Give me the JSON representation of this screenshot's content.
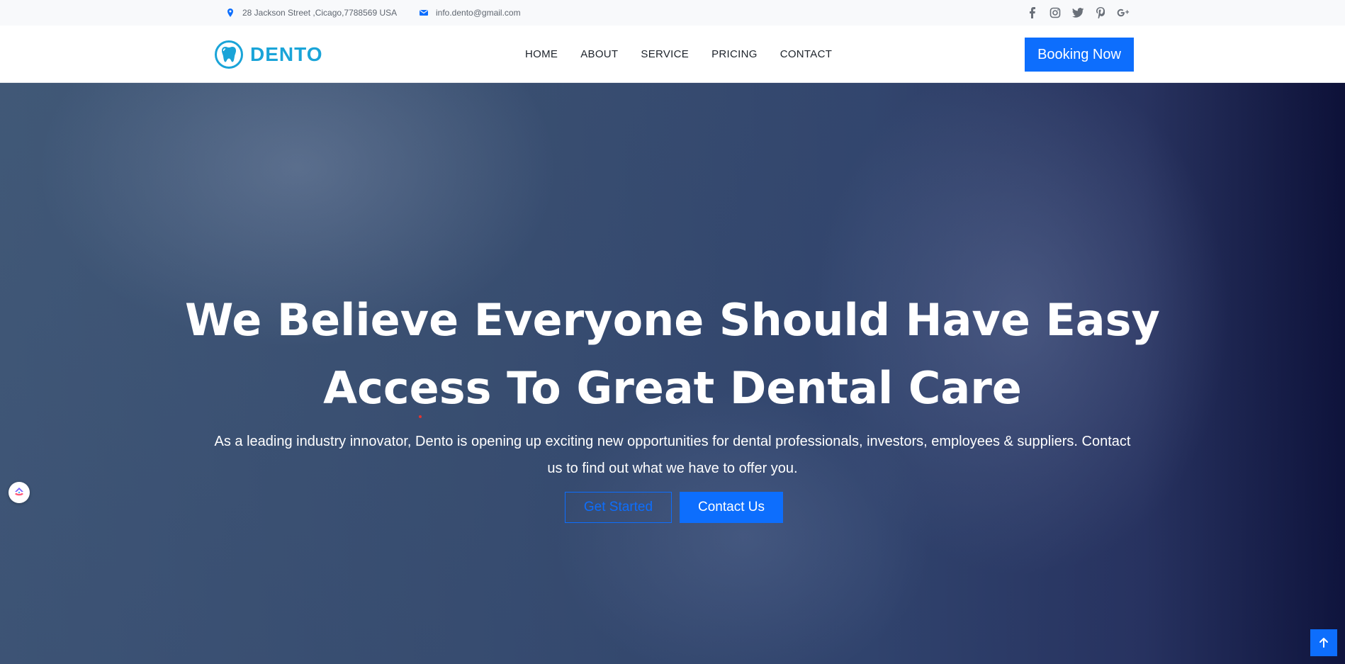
{
  "topbar": {
    "address": "28 Jackson Street ,Cicago,7788569 USA",
    "email": "info.dento@gmail.com",
    "address_icon": "map-pin-icon",
    "email_icon": "envelope-icon",
    "socials": [
      {
        "icon": "facebook-icon",
        "glyph": "f"
      },
      {
        "icon": "instagram-icon",
        "glyph": "◎"
      },
      {
        "icon": "twitter-icon",
        "glyph": "🐦"
      },
      {
        "icon": "pinterest-icon",
        "glyph": "P"
      },
      {
        "icon": "google-plus-icon",
        "glyph": "G+"
      }
    ]
  },
  "nav": {
    "brand": "DENTO",
    "items": [
      "HOME",
      "ABOUT",
      "SERVICE",
      "PRICING",
      "CONTACT"
    ],
    "cta": "Booking Now"
  },
  "hero": {
    "title_line1": "We Believe Everyone Should Have Easy",
    "title_line2": "Access To Great Dental Care",
    "subtitle": "As a leading industry innovator, Dento is opening up exciting new opportunities for dental professionals, investors, employees & suppliers. Contact us to find out what we have to offer you.",
    "btn_primary": "Get Started",
    "btn_secondary": "Contact Us"
  },
  "colors": {
    "accent": "#0d6efd",
    "brand": "#1aa4d8"
  }
}
